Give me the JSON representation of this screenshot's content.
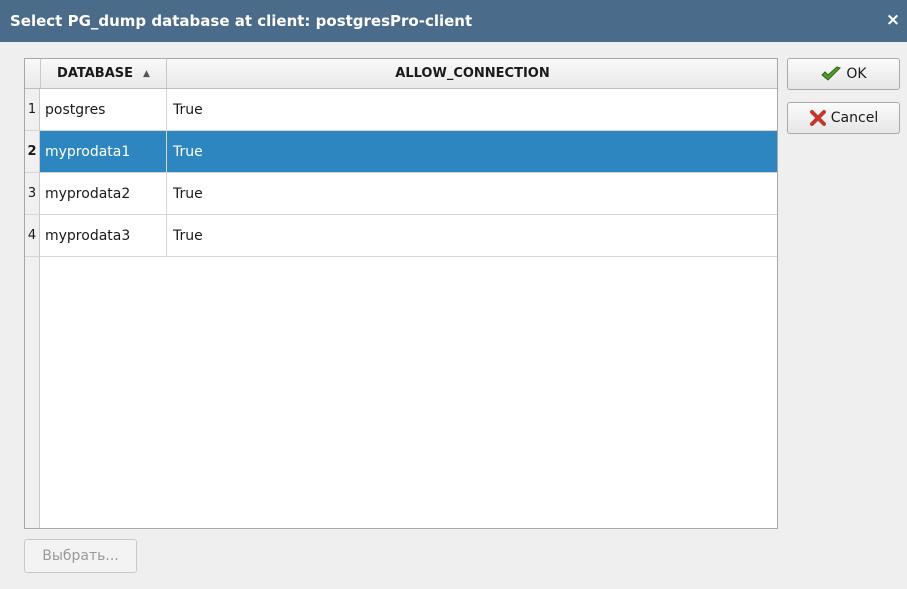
{
  "window": {
    "title": "Select PG_dump database at client: postgresPro-client",
    "close_glyph": "×"
  },
  "table": {
    "columns": [
      {
        "label": "DATABASE",
        "sort_indicator": "▲"
      },
      {
        "label": "ALLOW_CONNECTION"
      }
    ],
    "rows": [
      {
        "num": "1",
        "database": "postgres",
        "allow": "True",
        "selected": false
      },
      {
        "num": "2",
        "database": "myprodata1",
        "allow": "True",
        "selected": true
      },
      {
        "num": "3",
        "database": "myprodata2",
        "allow": "True",
        "selected": false
      },
      {
        "num": "4",
        "database": "myprodata3",
        "allow": "True",
        "selected": false
      }
    ]
  },
  "buttons": {
    "ok": {
      "label": "OK",
      "icon": "green-check-icon"
    },
    "cancel": {
      "label": "Cancel",
      "icon": "red-x-icon"
    },
    "choose": {
      "label": "Выбрать...",
      "enabled": false
    }
  },
  "colors": {
    "titlebar": "#4a6b8a",
    "selection": "#2e86c1"
  }
}
